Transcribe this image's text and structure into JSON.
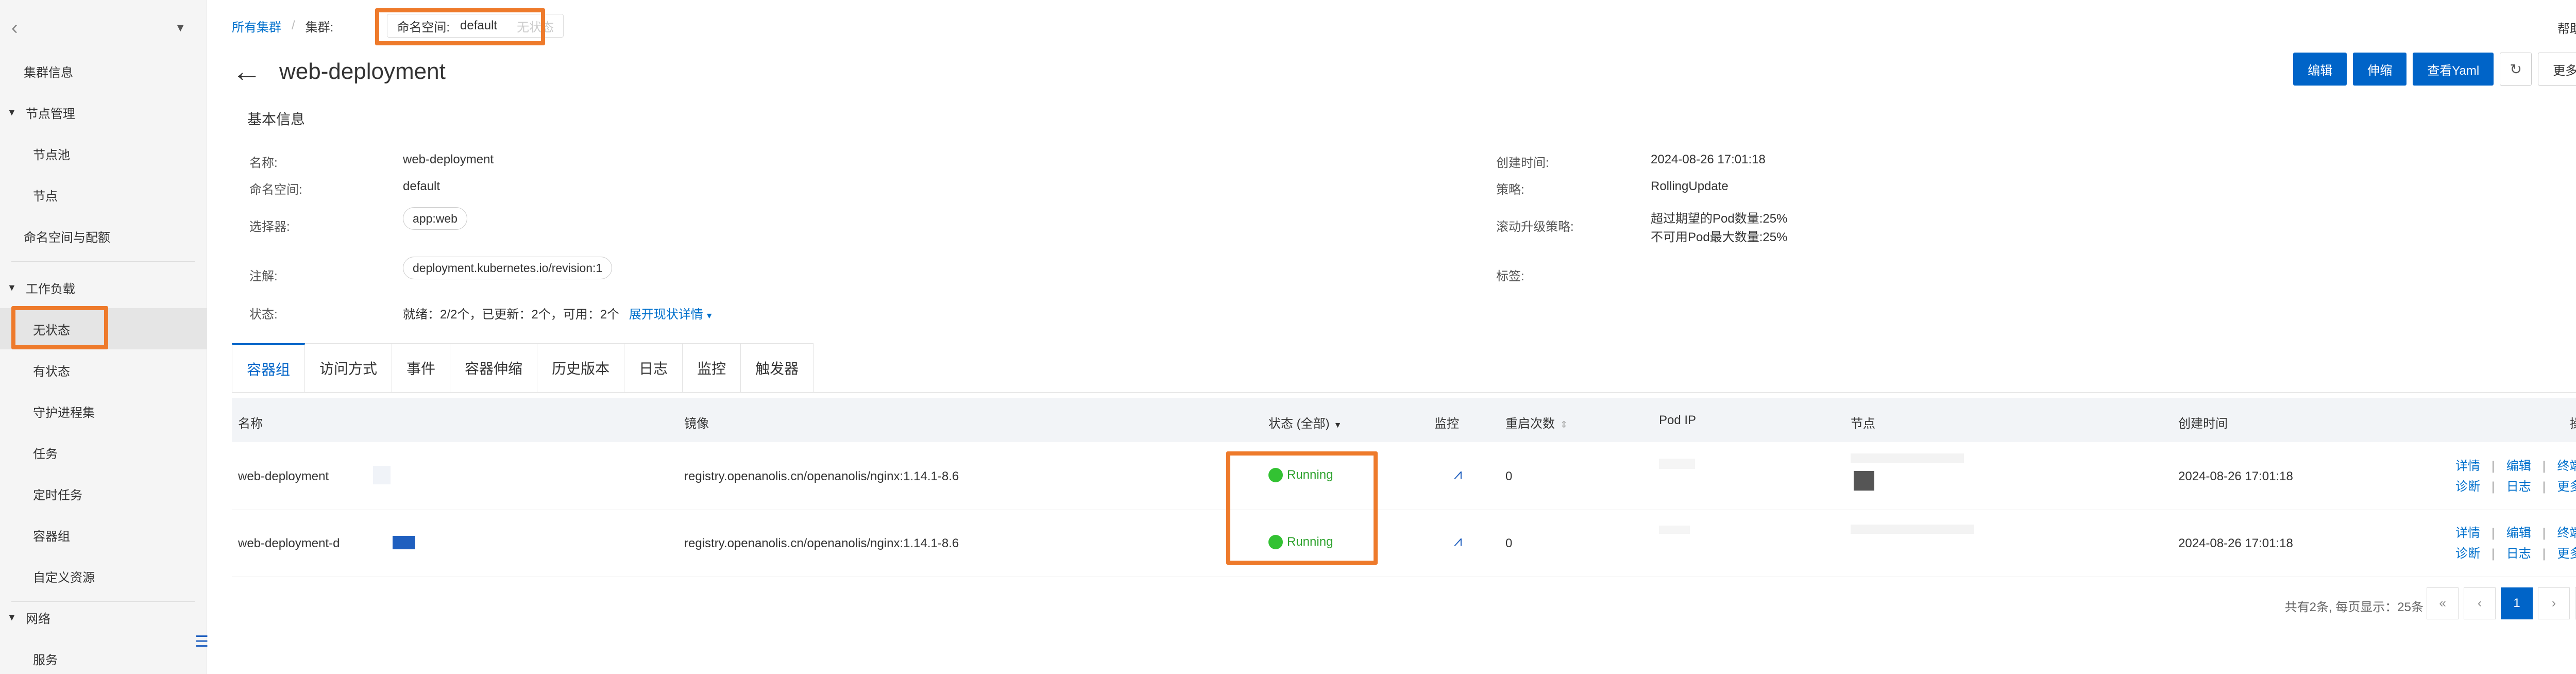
{
  "sidebar": {
    "items": [
      {
        "label": "集群信息"
      },
      {
        "label": "节点管理"
      },
      {
        "label": "节点池"
      },
      {
        "label": "节点"
      },
      {
        "label": "命名空间与配额"
      },
      {
        "label": "工作负载"
      },
      {
        "label": "无状态"
      },
      {
        "label": "有状态"
      },
      {
        "label": "守护进程集"
      },
      {
        "label": "任务"
      },
      {
        "label": "定时任务"
      },
      {
        "label": "容器组"
      },
      {
        "label": "自定义资源"
      },
      {
        "label": "网络"
      },
      {
        "label": "服务"
      }
    ]
  },
  "topbar": {
    "crumb_all": "所有集群",
    "crumb_sep": "/",
    "crumb_cluster": "集群:",
    "ns_label": "命名空间:",
    "ns_value": "default",
    "ns_faint": "无状态",
    "help": "帮助文档"
  },
  "header": {
    "title": "web-deployment",
    "actions": {
      "edit": "编辑",
      "scale": "伸缩",
      "yaml": "查看Yaml",
      "more": "更多"
    }
  },
  "basic": {
    "title": "基本信息",
    "name_label": "名称:",
    "name_value": "web-deployment",
    "ns_label": "命名空间:",
    "ns_value": "default",
    "selector_label": "选择器:",
    "selector_value": "app:web",
    "annotation_label": "注解:",
    "annotation_value": "deployment.kubernetes.io/revision:1",
    "status_label": "状态:",
    "status_value": "就绪：2/2个，已更新：2个，可用：2个",
    "status_link": "展开现状详情",
    "created_label": "创建时间:",
    "created_value": "2024-08-26 17:01:18",
    "strategy_label": "策略:",
    "strategy_value": "RollingUpdate",
    "rolling_label": "滚动升级策略:",
    "rolling_value_1": "超过期望的Pod数量:25%",
    "rolling_value_2": "不可用Pod最大数量:25%",
    "labels_label": "标签:"
  },
  "tabs": [
    {
      "label": "容器组"
    },
    {
      "label": "访问方式"
    },
    {
      "label": "事件"
    },
    {
      "label": "容器伸缩"
    },
    {
      "label": "历史版本"
    },
    {
      "label": "日志"
    },
    {
      "label": "监控"
    },
    {
      "label": "触发器"
    }
  ],
  "table": {
    "headers": {
      "name": "名称",
      "image": "镜像",
      "status": "状态 (全部)",
      "monitor": "监控",
      "restarts": "重启次数",
      "pod_ip": "Pod IP",
      "node": "节点",
      "created": "创建时间",
      "ops": "操作"
    },
    "rows": [
      {
        "name": "web-deployment",
        "image": "registry.openanolis.cn/openanolis/nginx:1.14.1-8.6",
        "status": "Running",
        "restarts": "0",
        "created": "2024-08-26 17:01:18",
        "op_detail": "详情",
        "op_edit": "编辑",
        "op_terminate": "终端",
        "op_diag": "诊断",
        "op_log": "日志",
        "op_more": "更多"
      },
      {
        "name": "web-deployment-d",
        "image": "registry.openanolis.cn/openanolis/nginx:1.14.1-8.6",
        "status": "Running",
        "restarts": "0",
        "created": "2024-08-26 17:01:18",
        "op_detail": "详情",
        "op_edit": "编辑",
        "op_terminate": "终端",
        "op_diag": "诊断",
        "op_log": "日志",
        "op_more": "更多"
      }
    ]
  },
  "pagination": {
    "summary": "共有2条, 每页显示：25条",
    "first": "«",
    "prev": "‹",
    "current": "1",
    "next": "›",
    "last": "»"
  }
}
